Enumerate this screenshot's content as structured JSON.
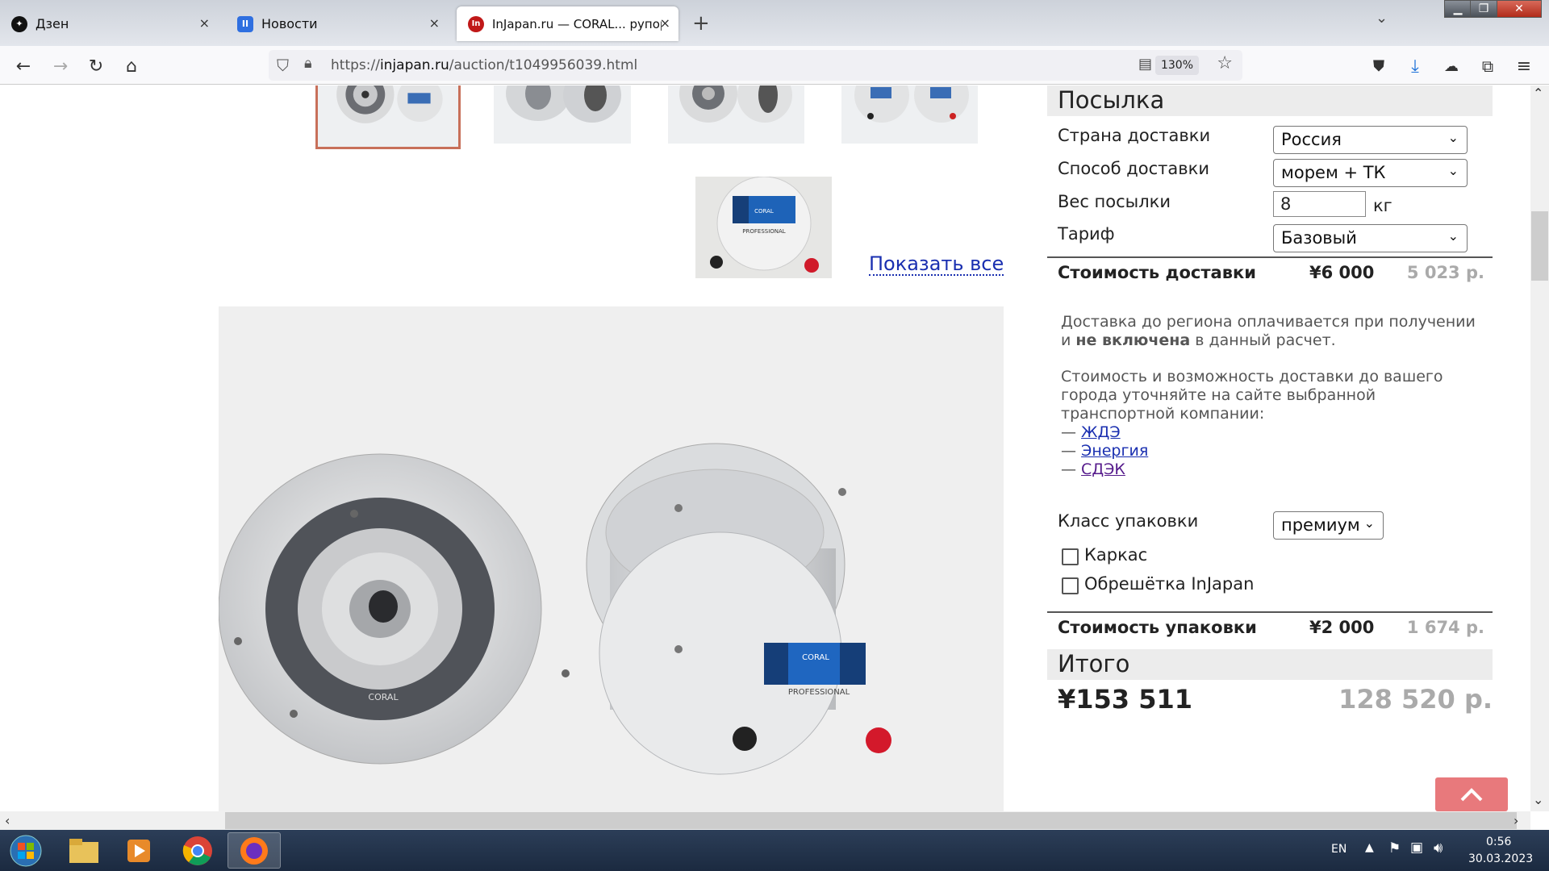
{
  "tabs": [
    {
      "title": "Дзен",
      "close": "×"
    },
    {
      "title": "Новости",
      "close": "×"
    },
    {
      "title": "InJapan.ru — CORAL... рупор т",
      "close": "×"
    }
  ],
  "new_tab": "+",
  "toolbar": {
    "url_prefix": "https://",
    "url_host": "injapan.ru",
    "url_path": "/auction/t1049956039.html",
    "zoom": "130%"
  },
  "gallery": {
    "show_all": "Показать все",
    "badge_text": "CORAL",
    "badge_sub": "PROFESSIONAL"
  },
  "parcel": {
    "title": "Посылка",
    "country_label": "Страна доставки",
    "country_value": "Россия",
    "method_label": "Способ доставки",
    "method_value": "морем + ТК",
    "weight_label": "Вес посылки",
    "weight_value": "8",
    "weight_unit": "кг",
    "tariff_label": "Тариф",
    "tariff_value": "Базовый",
    "delivery_cost_label": "Стоимость доставки",
    "delivery_cost_yen": "¥6 000",
    "delivery_cost_rub": "5 023 р.",
    "note1_a": "Доставка до региона оплачивается при получении и ",
    "note1_b": "не включена",
    "note1_c": " в данный расчет.",
    "note2": "Стоимость и возможность доставки до вашего города уточняйте на сайте выбранной транспортной компании:",
    "dash": "—",
    "links": [
      "ЖДЭ",
      "Энергия",
      "СДЭК"
    ],
    "pack_label": "Класс упаковки",
    "pack_value": "премиум",
    "frame_label": "Каркас",
    "crate_label": "Обрешётка InJapan",
    "pack_cost_label": "Стоимость упаковки",
    "pack_cost_yen": "¥2 000",
    "pack_cost_rub": "1 674 р.",
    "total_title": "Итого",
    "total_yen": "¥153 511",
    "total_rub": "128 520 р."
  },
  "taskbar": {
    "lang": "EN",
    "time": "0:56",
    "date": "30.03.2023"
  },
  "colors": {
    "link": "#1a2fb0",
    "visited": "#551a8b",
    "selected_thumb_border": "#c8705a",
    "scroll_top_button": "#e8797c"
  }
}
